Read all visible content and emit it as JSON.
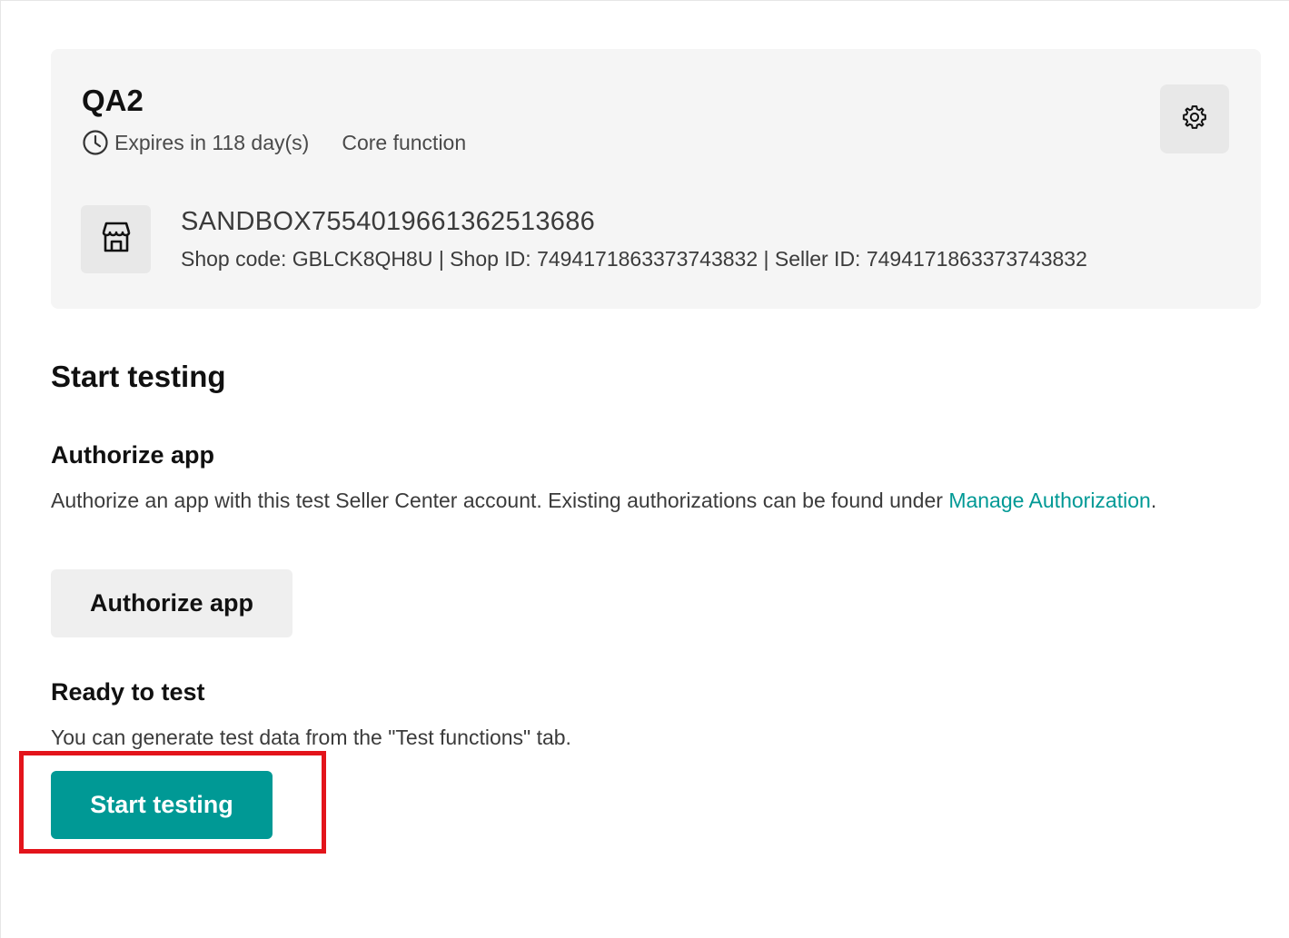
{
  "account": {
    "name": "QA2",
    "expires": "Expires in 118 day(s)",
    "scope": "Core function",
    "icons": {
      "expires": "clock-icon",
      "settings": "gear-icon",
      "shop": "store-icon"
    }
  },
  "shop": {
    "name": "SANDBOX7554019661362513686",
    "details": "Shop code: GBLCK8QH8U | Shop ID: 7494171863373743832 | Seller ID:  7494171863373743832"
  },
  "start_testing": {
    "title": "Start testing",
    "authorize": {
      "title": "Authorize app",
      "description": "Authorize an app with this test Seller Center account. Existing authorizations can be found under ",
      "link_text": "Manage Authorization",
      "trailing": ".",
      "button_label": "Authorize app"
    },
    "ready": {
      "title": "Ready to test",
      "description": "You can generate test data from the \"Test functions\" tab.",
      "button_label": "Start testing"
    }
  },
  "colors": {
    "accent": "#009995",
    "highlight": "#e3141b",
    "card_bg": "#f5f5f5"
  }
}
